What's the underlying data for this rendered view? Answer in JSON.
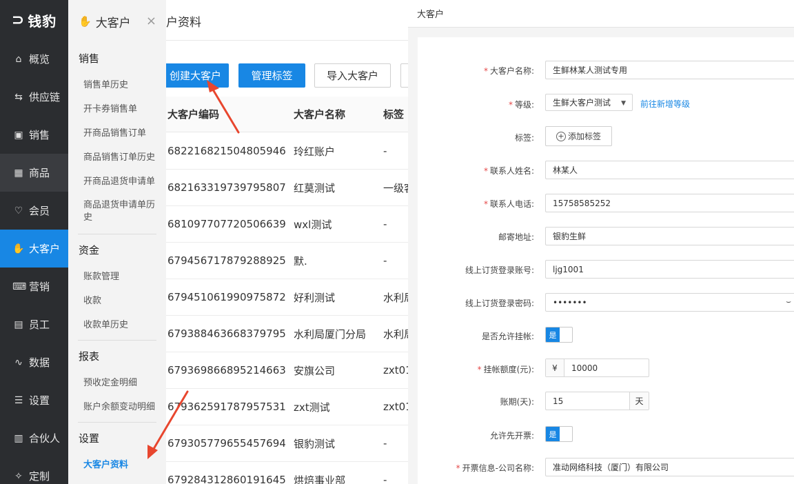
{
  "nav": {
    "logo_text": "钱豹",
    "items": [
      {
        "label": "概览",
        "icon": "home-icon",
        "glyph": "⌂"
      },
      {
        "label": "供应链",
        "icon": "supply-icon",
        "glyph": "⇆"
      },
      {
        "label": "销售",
        "icon": "sales-icon",
        "glyph": "▣"
      },
      {
        "label": "商品",
        "icon": "goods-icon",
        "glyph": "▦"
      },
      {
        "label": "会员",
        "icon": "member-icon",
        "glyph": "♡"
      },
      {
        "label": "大客户",
        "icon": "handshake-icon",
        "glyph": "✋"
      },
      {
        "label": "营销",
        "icon": "marketing-icon",
        "glyph": "⌨"
      },
      {
        "label": "员工",
        "icon": "staff-icon",
        "glyph": "▤"
      },
      {
        "label": "数据",
        "icon": "chart-icon",
        "glyph": "∿"
      },
      {
        "label": "设置",
        "icon": "settings-icon",
        "glyph": "☰"
      },
      {
        "label": "合伙人",
        "icon": "partner-icon",
        "glyph": "▥"
      },
      {
        "label": "定制",
        "icon": "custom-icon",
        "glyph": "✧"
      }
    ]
  },
  "submenu": {
    "title": "大客户",
    "close": "×",
    "sections": {
      "sales": {
        "title": "销售",
        "items": [
          "销售单历史",
          "开卡券销售单",
          "开商品销售订单",
          "商品销售订单历史",
          "开商品退货申请单",
          "商品退货申请单历史"
        ]
      },
      "funds": {
        "title": "资金",
        "items": [
          "账款管理",
          "收款",
          "收款单历史"
        ]
      },
      "report": {
        "title": "报表",
        "items": [
          "预收定金明细",
          "账户余额变动明细"
        ]
      },
      "settings": {
        "title": "设置",
        "items": [
          "大客户资料"
        ]
      }
    }
  },
  "list": {
    "page_title": "户资料",
    "buttons": {
      "create": "创建大客户",
      "tags": "管理标签",
      "import": "导入大客户"
    },
    "columns": {
      "code": "大客户编码",
      "name": "大客户名称",
      "tag": "标签"
    },
    "rows": [
      {
        "code": "682216821504805946",
        "name": "玲红账户",
        "tag": "-"
      },
      {
        "code": "682163319739795807",
        "name": "红莫测试",
        "tag": "一级客"
      },
      {
        "code": "681097707720506639",
        "name": "wxl测试",
        "tag": "-"
      },
      {
        "code": "679456717879288925",
        "name": "默.",
        "tag": "-"
      },
      {
        "code": "679451061990975872",
        "name": "好利测试",
        "tag": "水利局"
      },
      {
        "code": "679388463668379795",
        "name": "水利局厦门分局",
        "tag": "水利局"
      },
      {
        "code": "679369866895214663",
        "name": "安旗公司",
        "tag": "zxt01"
      },
      {
        "code": "679362591787957531",
        "name": "zxt测试",
        "tag": "zxt01"
      },
      {
        "code": "679305779655457694",
        "name": "银豹测试",
        "tag": "-"
      },
      {
        "code": "679284312860191645",
        "name": "烘焙事业部",
        "tag": "-"
      }
    ]
  },
  "form": {
    "panel_title": "大客户",
    "fields": {
      "name": {
        "label": "大客户名称:",
        "value": "生鲜林某人测试专用",
        "required": "*"
      },
      "level": {
        "label": "等级:",
        "value": "生鲜大客户测试",
        "required": "*",
        "link": "前往新增等级"
      },
      "tags": {
        "label": "标签:",
        "button": "添加标签"
      },
      "contact": {
        "label": "联系人姓名:",
        "value": "林某人",
        "required": "*"
      },
      "phone": {
        "label": "联系人电话:",
        "value": "15758585252",
        "required": "*"
      },
      "address": {
        "label": "邮寄地址:",
        "value": "银豹生鲜"
      },
      "account": {
        "label": "线上订货登录账号:",
        "value": "ljg1001"
      },
      "password": {
        "label": "线上订货登录密码:",
        "value": "•••••••"
      },
      "credit_allowed": {
        "label": "是否允许挂帐:",
        "switch": "是"
      },
      "credit_limit": {
        "label": "挂帐额度(元):",
        "value": "10000",
        "required": "*",
        "prefix": "¥"
      },
      "term": {
        "label": "账期(天):",
        "value": "15",
        "suffix": "天"
      },
      "invoice_first": {
        "label": "允许先开票:",
        "switch": "是"
      },
      "invoice_company": {
        "label": "开票信息-公司名称:",
        "value": "准动网络科技（厦门）有限公司",
        "required": "*"
      }
    }
  },
  "colors": {
    "accent": "#1887e4",
    "nav_bg": "#2b2d30",
    "arrow": "#e8462e"
  }
}
